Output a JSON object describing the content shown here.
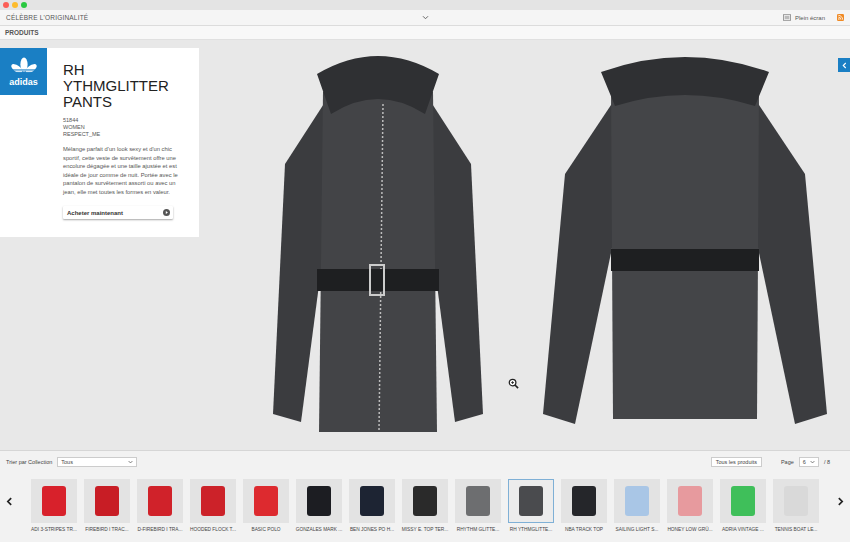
{
  "header": {
    "title": "CÉLÈBRE L'ORIGINALITÉ",
    "fullscreen": "Plein écran"
  },
  "section": "PRODUITS",
  "brand": "adidas",
  "product": {
    "title": "RH YTHMGLITTER PANTS",
    "code": "51844",
    "gender": "WOMEN",
    "collection": "RESPECT_ME",
    "description": "Mélange parfait d'un look sexy et d'un chic sportif, cette veste de survêtement offre une encolure dégagée et une taille ajustée et est idéale de jour comme de nuit. Portée avec le pantalon de survêtement assorti ou avec un jean, elle met toutes les formes en valeur.",
    "buy_button": "Acheter maintenant"
  },
  "filter": {
    "label": "Trier par Collection",
    "value": "Tous"
  },
  "all_products": "Tous les produits",
  "pagination": {
    "label": "Page",
    "current": "6",
    "total": "/ 8"
  },
  "thumbnails": [
    {
      "caption": "ADI 3-STRIPES TR...",
      "selected": false,
      "color": "#d8212b"
    },
    {
      "caption": "FIREBIRD I TRAC...",
      "selected": false,
      "color": "#c81d25"
    },
    {
      "caption": "D-FIREBIRD I TRA...",
      "selected": false,
      "color": "#d0222a"
    },
    {
      "caption": "HOODED FLOCK T...",
      "selected": false,
      "color": "#cc2229"
    },
    {
      "caption": "BASIC POLO",
      "selected": false,
      "color": "#dd2a2f"
    },
    {
      "caption": "GONZALES MARK ...",
      "selected": false,
      "color": "#1c1d22"
    },
    {
      "caption": "BEN JONES PO H...",
      "selected": false,
      "color": "#1d2433"
    },
    {
      "caption": "MISSY E. TOP TER...",
      "selected": false,
      "color": "#2a2a2a"
    },
    {
      "caption": "RHYTHM GLITTE...",
      "selected": false,
      "color": "#6d6e70"
    },
    {
      "caption": "RH YTHMGLITTE...",
      "selected": true,
      "color": "#4a4b4e"
    },
    {
      "caption": "NBA TRACK TOP",
      "selected": false,
      "color": "#25262a"
    },
    {
      "caption": "SAILING LIGHT S...",
      "selected": false,
      "color": "#a9c6e6"
    },
    {
      "caption": "HONEY LOW GRÜ...",
      "selected": false,
      "color": "#e79a9e"
    },
    {
      "caption": "ADRIA VINTAGE ...",
      "selected": false,
      "color": "#3fbf5a"
    },
    {
      "caption": "TENNIS BOAT LE...",
      "selected": false,
      "color": "#d9d9d9"
    }
  ]
}
